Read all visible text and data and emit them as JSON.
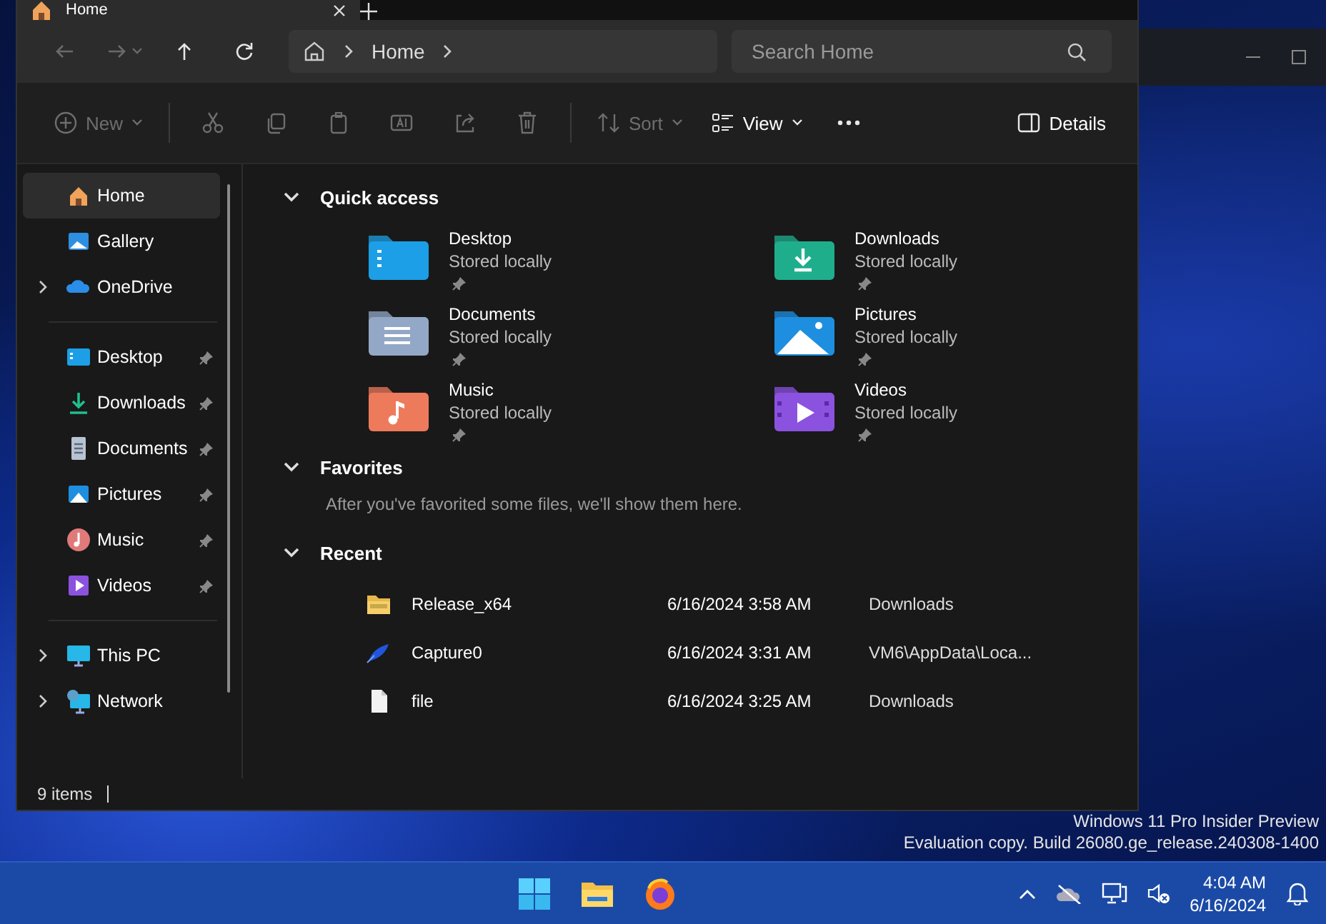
{
  "tab": {
    "title": "Home"
  },
  "nav_buttons": [
    {
      "kind": "back",
      "disabled": true
    },
    {
      "kind": "forward",
      "disabled": true
    },
    {
      "kind": "up",
      "disabled": false
    },
    {
      "kind": "refresh",
      "disabled": false
    }
  ],
  "address": {
    "crumbs": [
      "Home"
    ]
  },
  "search": {
    "placeholder": "Search Home"
  },
  "toolbar": [
    {
      "kind": "new",
      "label": "New",
      "disabled": true
    },
    {
      "kind": "cut",
      "disabled": true
    },
    {
      "kind": "copy",
      "disabled": true
    },
    {
      "kind": "paste",
      "disabled": true
    },
    {
      "kind": "rename",
      "disabled": true
    },
    {
      "kind": "share",
      "disabled": true
    },
    {
      "kind": "delete",
      "disabled": true
    },
    {
      "kind": "sort",
      "label": "Sort",
      "disabled": true
    },
    {
      "kind": "view",
      "label": "View",
      "disabled": false
    },
    {
      "kind": "more",
      "disabled": false
    },
    {
      "kind": "details",
      "label": "Details",
      "disabled": false
    }
  ],
  "sidebar": {
    "sections": [
      {
        "items": [
          {
            "kind": "home",
            "label": "Home",
            "selected": true,
            "expandable": false,
            "pinned": false
          },
          {
            "kind": "gallery",
            "label": "Gallery",
            "selected": false,
            "expandable": false,
            "pinned": false
          },
          {
            "kind": "onedrive",
            "label": "OneDrive",
            "selected": false,
            "expandable": true,
            "pinned": false
          }
        ]
      },
      {
        "items": [
          {
            "kind": "desktop",
            "label": "Desktop",
            "selected": false,
            "expandable": false,
            "pinned": true
          },
          {
            "kind": "downloads",
            "label": "Downloads",
            "selected": false,
            "expandable": false,
            "pinned": true
          },
          {
            "kind": "documents",
            "label": "Documents",
            "selected": false,
            "expandable": false,
            "pinned": true
          },
          {
            "kind": "pictures",
            "label": "Pictures",
            "selected": false,
            "expandable": false,
            "pinned": true
          },
          {
            "kind": "music",
            "label": "Music",
            "selected": false,
            "expandable": false,
            "pinned": true
          },
          {
            "kind": "videos",
            "label": "Videos",
            "selected": false,
            "expandable": false,
            "pinned": true
          }
        ]
      },
      {
        "items": [
          {
            "kind": "pc",
            "label": "This PC",
            "selected": false,
            "expandable": true,
            "pinned": false
          },
          {
            "kind": "network",
            "label": "Network",
            "selected": false,
            "expandable": true,
            "pinned": false
          }
        ]
      }
    ]
  },
  "status_bar": {
    "count": "9 items"
  },
  "quick_access": {
    "title": "Quick access",
    "expanded": true,
    "items": [
      {
        "kind": "desktop",
        "name": "Desktop",
        "location": "Stored locally",
        "pinned": true
      },
      {
        "kind": "downloads",
        "name": "Downloads",
        "location": "Stored locally",
        "pinned": true
      },
      {
        "kind": "documents",
        "name": "Documents",
        "location": "Stored locally",
        "pinned": true
      },
      {
        "kind": "pictures",
        "name": "Pictures",
        "location": "Stored locally",
        "pinned": true
      },
      {
        "kind": "music",
        "name": "Music",
        "location": "Stored locally",
        "pinned": true
      },
      {
        "kind": "videos",
        "name": "Videos",
        "location": "Stored locally",
        "pinned": true
      }
    ]
  },
  "favorites": {
    "title": "Favorites",
    "expanded": true,
    "message": "After you've favorited some files, we'll show them here."
  },
  "recent": {
    "title": "Recent",
    "expanded": true,
    "rows": [
      {
        "kind": "zip",
        "name": "Release_x64",
        "date": "6/16/2024 3:58 AM",
        "location": "Downloads"
      },
      {
        "kind": "image",
        "name": "Capture0",
        "date": "6/16/2024 3:31 AM",
        "location": "VM6\\AppData\\Loca..."
      },
      {
        "kind": "file",
        "name": "file",
        "date": "6/16/2024 3:25 AM",
        "location": "Downloads"
      }
    ]
  },
  "watermark": {
    "edition": "Windows 11 Pro Insider Preview",
    "build": "Evaluation copy. Build 26080.ge_release.240308-1400"
  },
  "taskbar": {
    "time": "4:04 AM",
    "date": "6/16/2024"
  }
}
